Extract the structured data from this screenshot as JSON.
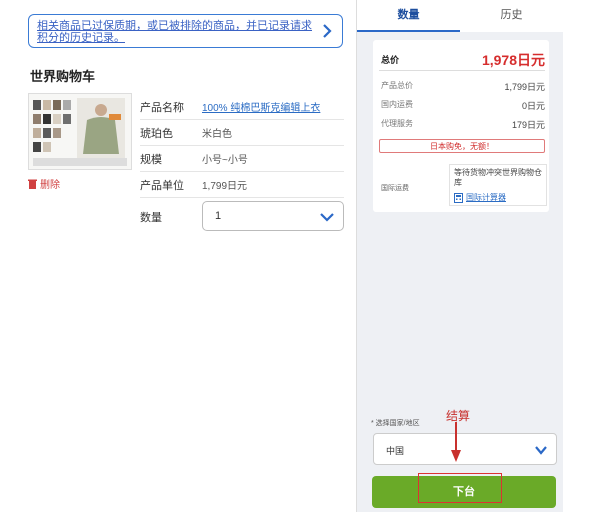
{
  "notice": {
    "text": "相关商品已过保质期，或已被排除的商品，并已记录请求积分的历史记录。"
  },
  "cart": {
    "title": "世界购物车",
    "delete_label": "删除",
    "rows": [
      {
        "label": "产品名称",
        "value": "100% 纯棉巴斯克编辑上衣"
      },
      {
        "label": "琥珀色",
        "value": "米白色"
      },
      {
        "label": "规模",
        "value": "小号~小号"
      },
      {
        "label": "产品单位",
        "value": "1,799日元"
      }
    ],
    "quantity_label": "数量",
    "quantity_value": "1"
  },
  "sidebar": {
    "tabs": [
      {
        "label": "数量"
      },
      {
        "label": "历史"
      }
    ],
    "total_label": "总价",
    "total_value": "1,978日元",
    "lines": [
      {
        "label": "产品总价",
        "value": "1,799日元"
      },
      {
        "label": "国内运费",
        "value": "0日元"
      },
      {
        "label": "代理服务",
        "value": "179日元"
      }
    ],
    "free_notice": "日本购免，无额！",
    "intl_label": "国际运费",
    "intl_text": "等待货物冲突世界购物仓库",
    "calc_link": "国际计算器",
    "country_hint": "* 选择国家/地区",
    "country_value": "中国",
    "checkout_annotation": "结算",
    "order_button": "下台"
  },
  "colors": {
    "accent": "#2a68c7",
    "price": "#d62d2d",
    "order": "#6aaa28",
    "annotation": "#c8312e"
  }
}
